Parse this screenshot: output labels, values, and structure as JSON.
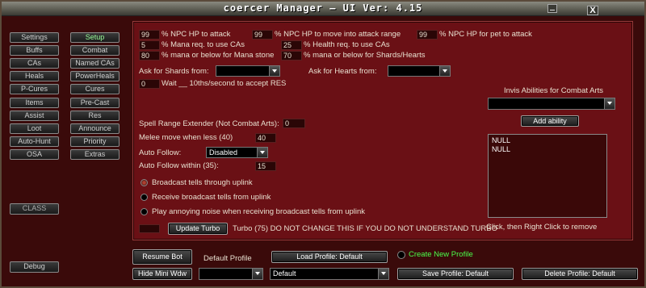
{
  "window": {
    "title": "coercer Manager   — UI Ver: 4.15",
    "close_glyph": "X"
  },
  "nav_left": [
    "Settings",
    "Buffs",
    "CAs",
    "Heals",
    "P-Cures",
    "Items",
    "Assist",
    "Loot",
    "Auto-Hunt",
    "OSA"
  ],
  "nav_right": [
    "Setup",
    "Combat",
    "Named CAs",
    "PowerHeals",
    "Cures",
    "Pre-Cast",
    "Res",
    "Announce",
    "Priority",
    "Extras"
  ],
  "class_button": "CLASS",
  "debug_button": "Debug",
  "setup": {
    "npc_hp_attack": {
      "value": "99",
      "label": "% NPC HP to attack"
    },
    "npc_hp_move": {
      "value": "99",
      "label": "% NPC HP to move into attack range"
    },
    "npc_hp_pet": {
      "value": "99",
      "label": "% NPC HP for pet to attack"
    },
    "mana_cas": {
      "value": "5",
      "label": "% Mana req. to use CAs"
    },
    "health_cas": {
      "value": "25",
      "label": "% Health req. to use CAs"
    },
    "mana_stone": {
      "value": "80",
      "label": "% mana or below for Mana stone"
    },
    "mana_shards": {
      "value": "70",
      "label": "% mana or below for Shards/Hearts"
    },
    "ask_shards_label": "Ask for Shards from:",
    "ask_hearts_label": "Ask for Hearts from:",
    "res_wait": {
      "value": "0",
      "label": "Wait __ 10ths/second to accept RES"
    },
    "invis_label": "Invis Abilities for Combat Arts",
    "add_ability": "Add ability",
    "spell_range_label": "Spell Range Extender (Not Combat Arts):",
    "spell_range_value": "0",
    "melee_move_label": "Melee move when less (40)",
    "melee_move_value": "40",
    "auto_follow_label": "Auto Follow:",
    "auto_follow_value": "Disabled",
    "auto_follow_within_label": "Auto Follow within (35):",
    "auto_follow_within_value": "15",
    "radio_broadcast": "Broadcast tells through uplink",
    "radio_receive": "Receive broadcast tells from uplink",
    "radio_noise": "Play annoying noise when receiving broadcast tells from uplink",
    "update_turbo": "Update Turbo",
    "turbo_note": "Turbo (75) DO NOT CHANGE THIS IF YOU DO NOT UNDERSTAND TURBO",
    "list_items": [
      "NULL",
      "NULL"
    ],
    "list_hint": "Click, then Right Click to remove"
  },
  "bottom": {
    "resume_bot": "Resume Bot",
    "default_profile_label": "Default Profile",
    "load_profile": "Load Profile: Default",
    "create_profile": "Create New Profile",
    "hide_mini": "Hide Mini Wdw",
    "profile_select": "Default",
    "save_profile": "Save Profile: Default",
    "delete_profile": "Delete Profile: Default"
  }
}
